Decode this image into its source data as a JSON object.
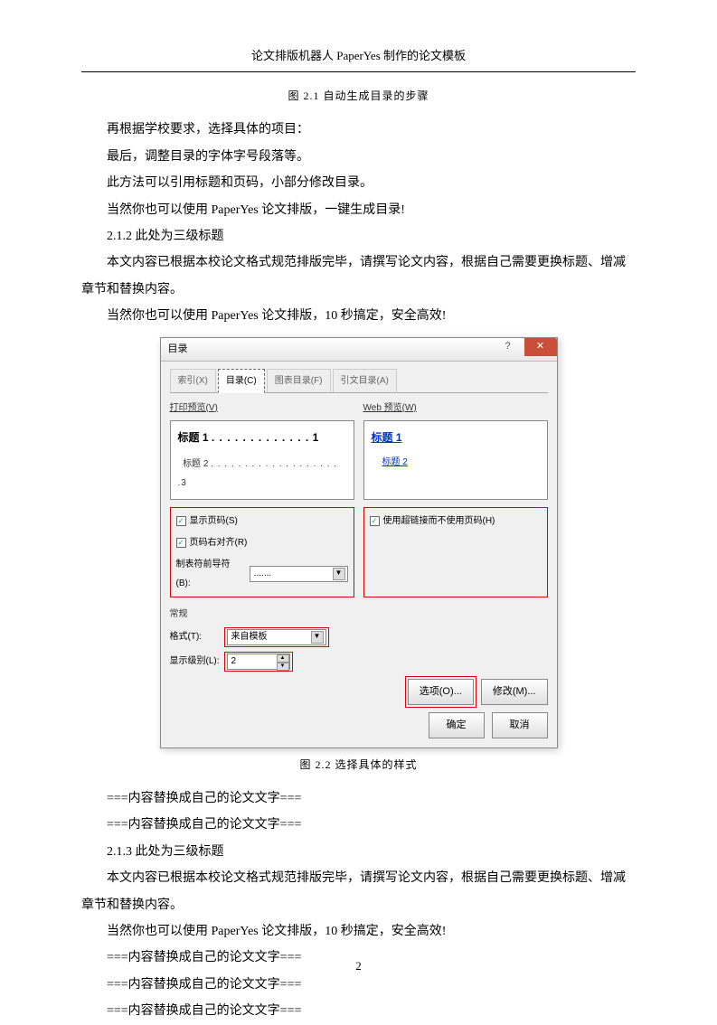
{
  "header": "论文排版机器人 PaperYes 制作的论文模板",
  "figure21": "图 2.1  自动生成目录的步骤",
  "p1": "再根据学校要求，选择具体的项目：",
  "p2": "最后，调整目录的字体字号段落等。",
  "p3": "此方法可以引用标题和页码，小部分修改目录。",
  "p4": "当然你也可以使用 PaperYes 论文排版，一键生成目录!",
  "h212": "2.1.2  此处为三级标题",
  "p5": "本文内容已根据本校论文格式规范排版完毕，请撰写论文内容，根据自己需要更换标题、增减章节和替换内容。",
  "p6": "当然你也可以使用 PaperYes 论文排版，10 秒搞定，安全高效!",
  "dialog": {
    "title": "目录",
    "tabs": [
      "索引(X)",
      "目录(C)",
      "图表目录(F)",
      "引文目录(A)"
    ],
    "preview_left_label": "打印预览(V)",
    "preview_right_label": "Web 预览(W)",
    "prev_h1": "标题 1",
    "prev_h1_page": "1",
    "prev_h2": "标题 2",
    "prev_h2_page": "3",
    "web_h1": "标题 1",
    "web_h2": "标题 2",
    "cb_show_page": "显示页码(S)",
    "cb_right_align": "页码右对齐(R)",
    "cb_hyperlink": "使用超链接而不使用页码(H)",
    "leader_label": "制表符前导符(B):",
    "leader_value": ".......",
    "general_label": "常规",
    "format_label": "格式(T):",
    "format_value": "来自模板",
    "levels_label": "显示级别(L):",
    "levels_value": "2",
    "btn_options": "选项(O)...",
    "btn_modify": "修改(M)...",
    "btn_ok": "确定",
    "btn_cancel": "取消"
  },
  "figure22": "图 2.2  选择具体的样式",
  "replace1": "===内容替换成自己的论文文字===",
  "replace2": "===内容替换成自己的论文文字===",
  "h213": "2.1.3  此处为三级标题",
  "p7": "本文内容已根据本校论文格式规范排版完毕，请撰写论文内容，根据自己需要更换标题、增减章节和替换内容。",
  "p8": "当然你也可以使用 PaperYes 论文排版，10 秒搞定，安全高效!",
  "replace3": "===内容替换成自己的论文文字===",
  "replace4": "===内容替换成自己的论文文字===",
  "replace5": "===内容替换成自己的论文文字===",
  "page_number": "2"
}
